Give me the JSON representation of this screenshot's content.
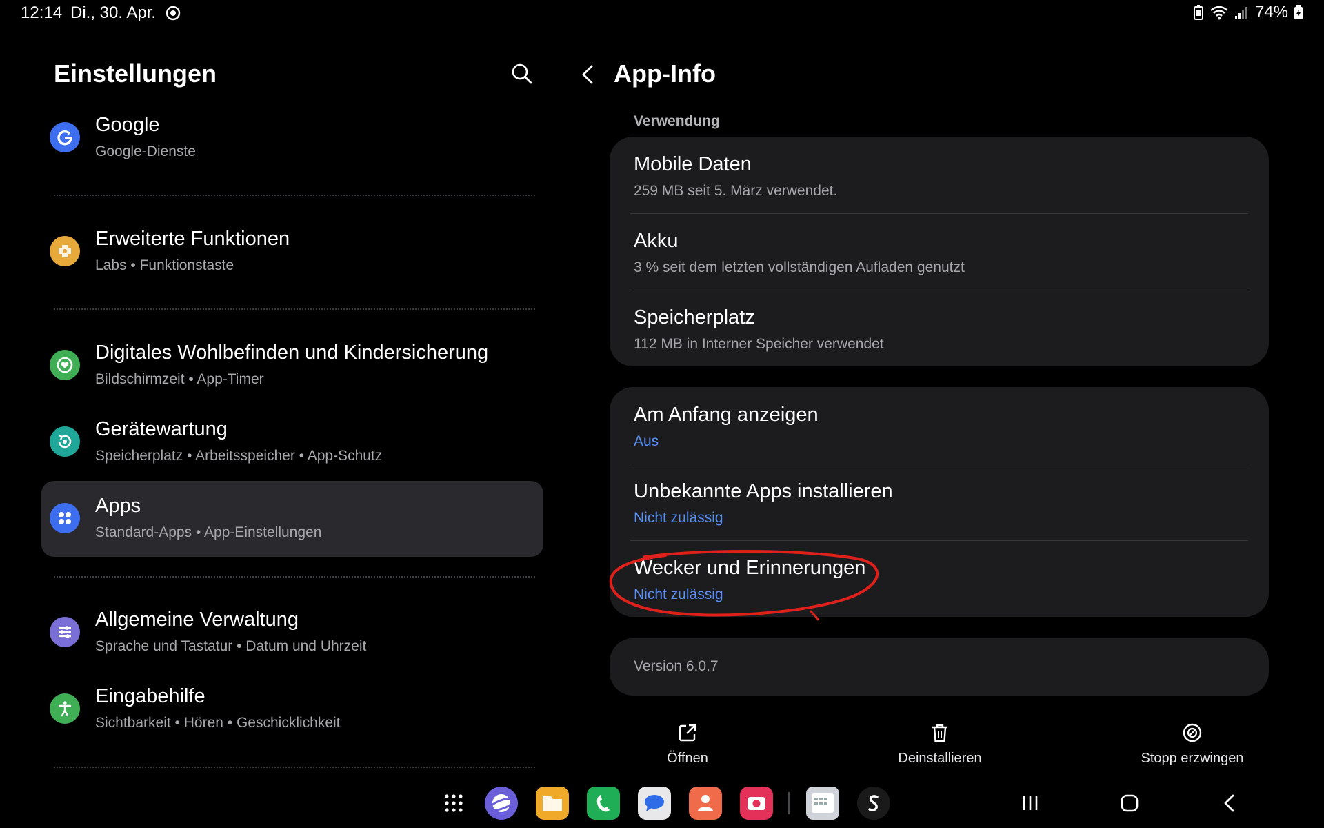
{
  "status": {
    "time": "12:14",
    "date": "Di., 30. Apr.",
    "battery": "74%"
  },
  "left": {
    "title": "Einstellungen",
    "items": [
      {
        "title": "Google",
        "subtitle": "Google-Dienste",
        "icon": "google-icon",
        "color": "#3d6ef0"
      },
      {
        "title": "Erweiterte Funktionen",
        "subtitle": "Labs  •  Funktionstaste",
        "icon": "puzzle-icon",
        "color": "#e6a93a"
      },
      {
        "title": "Digitales Wohlbefinden und Kindersicherung",
        "subtitle": "Bildschirmzeit  •  App-Timer",
        "icon": "wellbeing-icon",
        "color": "#3fae55"
      },
      {
        "title": "Gerätewartung",
        "subtitle": "Speicherplatz  •  Arbeitsspeicher  •  App-Schutz",
        "icon": "device-care-icon",
        "color": "#1fa89a"
      },
      {
        "title": "Apps",
        "subtitle": "Standard-Apps  •  App-Einstellungen",
        "icon": "apps-grid-icon",
        "color": "#3d6ef0"
      },
      {
        "title": "Allgemeine Verwaltung",
        "subtitle": "Sprache und Tastatur  •  Datum und Uhrzeit",
        "icon": "sliders-icon",
        "color": "#7a6fd6"
      },
      {
        "title": "Eingabehilfe",
        "subtitle": "Sichtbarkeit  •  Hören  •  Geschicklichkeit",
        "icon": "accessibility-icon",
        "color": "#3fae55"
      }
    ]
  },
  "right": {
    "title": "App-Info",
    "section_label": "Verwendung",
    "usage": [
      {
        "title": "Mobile Daten",
        "subtitle": "259 MB seit 5. März verwendet."
      },
      {
        "title": "Akku",
        "subtitle": "3 % seit dem letzten vollständigen Aufladen genutzt"
      },
      {
        "title": "Speicherplatz",
        "subtitle": "112 MB in Interner Speicher verwendet"
      }
    ],
    "permissions": [
      {
        "title": "Am Anfang anzeigen",
        "value": "Aus"
      },
      {
        "title": "Unbekannte Apps installieren",
        "value": "Nicht zulässig"
      },
      {
        "title": "Wecker und Erinnerungen",
        "value": "Nicht zulässig"
      }
    ],
    "version": "Version 6.0.7",
    "actions": {
      "open": "Öffnen",
      "uninstall": "Deinstallieren",
      "force_stop": "Stopp erzwingen"
    }
  },
  "colors": {
    "accent_blue": "#5a8ff5",
    "annotation_red": "#e0211b",
    "card_bg": "#1c1c1f"
  }
}
